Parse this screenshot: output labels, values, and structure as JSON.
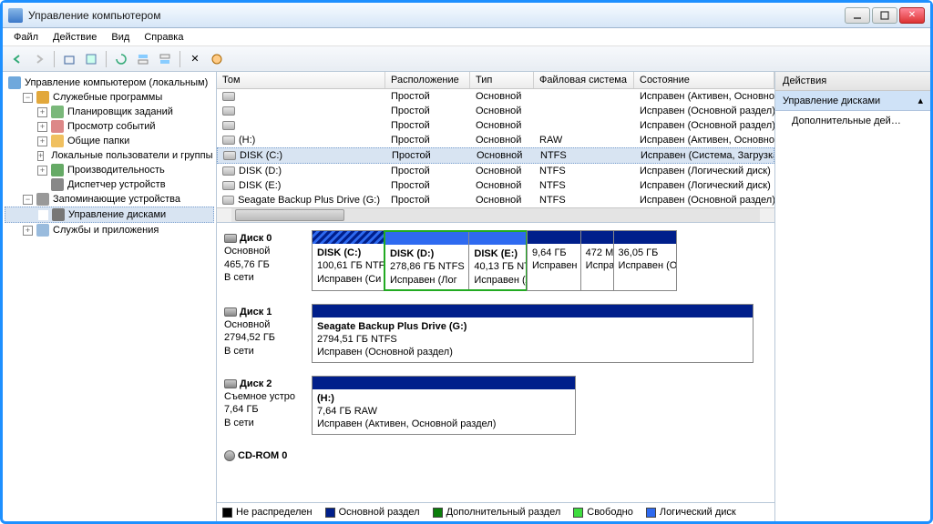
{
  "window": {
    "title": "Управление компьютером"
  },
  "menu": {
    "file": "Файл",
    "action": "Действие",
    "view": "Вид",
    "help": "Справка"
  },
  "tree": {
    "root": "Управление компьютером (локальным)",
    "svc": "Служебные программы",
    "sched": "Планировщик заданий",
    "event": "Просмотр событий",
    "shared": "Общие папки",
    "users": "Локальные пользователи и группы",
    "perf": "Производительность",
    "devmgr": "Диспетчер устройств",
    "storage": "Запоминающие устройства",
    "diskmgmt": "Управление дисками",
    "services": "Службы и приложения"
  },
  "cols": {
    "vol": "Том",
    "layout": "Расположение",
    "type": "Тип",
    "fs": "Файловая система",
    "status": "Состояние"
  },
  "vals": {
    "simple": "Простой",
    "basic": "Основной"
  },
  "volumes": [
    {
      "name": "",
      "fs": "",
      "status": "Исправен (Активен, Основной раздел)"
    },
    {
      "name": "",
      "fs": "",
      "status": "Исправен (Основной раздел)"
    },
    {
      "name": "",
      "fs": "",
      "status": "Исправен (Основной раздел)"
    },
    {
      "name": "(H:)",
      "fs": "RAW",
      "status": "Исправен (Активен, Основной раздел)"
    },
    {
      "name": "DISK (C:)",
      "fs": "NTFS",
      "status": "Исправен (Система, Загрузка, Файл по",
      "sel": true
    },
    {
      "name": "DISK (D:)",
      "fs": "NTFS",
      "status": "Исправен (Логический диск)"
    },
    {
      "name": "DISK (E:)",
      "fs": "NTFS",
      "status": "Исправен (Логический диск)"
    },
    {
      "name": "Seagate Backup Plus Drive (G:)",
      "fs": "NTFS",
      "status": "Исправен (Основной раздел)"
    }
  ],
  "disks": {
    "d0": {
      "name": "Диск 0",
      "type": "Основной",
      "size": "465,76 ГБ",
      "state": "В сети",
      "p0": {
        "name": "DISK  (C:)",
        "size": "100,61 ГБ NTFS",
        "status": "Исправен (Си"
      },
      "p1": {
        "name": "DISK  (D:)",
        "size": "278,86 ГБ NTFS",
        "status": "Исправен (Лог"
      },
      "p2": {
        "name": "DISK  (E:)",
        "size": "40,13 ГБ NTF",
        "status": "Исправен (Л"
      },
      "p3": {
        "name": "",
        "size": "9,64 ГБ",
        "status": "Исправен"
      },
      "p4": {
        "name": "",
        "size": "472 М",
        "status": "Испра"
      },
      "p5": {
        "name": "",
        "size": "36,05 ГБ",
        "status": "Исправен (О"
      }
    },
    "d1": {
      "name": "Диск 1",
      "type": "Основной",
      "size": "2794,52 ГБ",
      "state": "В сети",
      "p0": {
        "name": "Seagate Backup Plus Drive  (G:)",
        "size": "2794,51 ГБ NTFS",
        "status": "Исправен (Основной раздел)"
      }
    },
    "d2": {
      "name": "Диск 2",
      "type": "Съемное устро",
      "size": "7,64 ГБ",
      "state": "В сети",
      "p0": {
        "name": "  (H:)",
        "size": "7,64 ГБ RAW",
        "status": "Исправен (Активен, Основной раздел)"
      }
    },
    "d3": {
      "name": "CD-ROM 0"
    }
  },
  "legend": {
    "unalloc": "Не распределен",
    "primary": "Основной раздел",
    "extended": "Дополнительный раздел",
    "free": "Свободно",
    "logical": "Логический диск"
  },
  "actions": {
    "header": "Действия",
    "section": "Управление дисками",
    "more": "Дополнительные дей…"
  }
}
